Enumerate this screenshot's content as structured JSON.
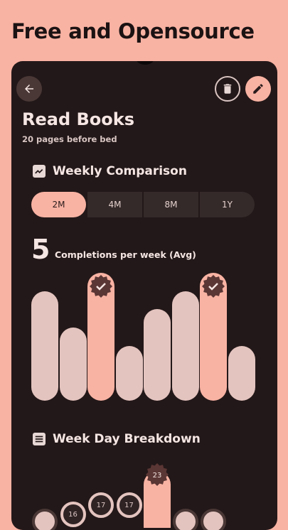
{
  "promo": {
    "title": "Free and Opensource"
  },
  "header": {
    "back_icon": "arrow-left-icon",
    "delete_icon": "trash-icon",
    "edit_icon": "pencil-icon"
  },
  "habit": {
    "title": "Read Books",
    "subtitle": "20 pages before bed"
  },
  "weekly": {
    "heading": "Weekly Comparison",
    "icon": "trending-up-icon",
    "ranges": [
      "2M",
      "4M",
      "8M",
      "1Y"
    ],
    "selected_range": "2M",
    "avg_value": "5",
    "avg_label": "Completions per week (Avg)",
    "bars": [
      {
        "value": 6,
        "highlight": false,
        "badge": false
      },
      {
        "value": 4,
        "highlight": false,
        "badge": false
      },
      {
        "value": 7,
        "highlight": true,
        "badge": true
      },
      {
        "value": 3,
        "highlight": false,
        "badge": false
      },
      {
        "value": 5,
        "highlight": false,
        "badge": false
      },
      {
        "value": 6,
        "highlight": false,
        "badge": false
      },
      {
        "value": 7,
        "highlight": true,
        "badge": true
      },
      {
        "value": 3,
        "highlight": false,
        "badge": false
      }
    ]
  },
  "weekday": {
    "heading": "Week Day Breakdown",
    "icon": "calendar-icon",
    "values": [
      "",
      "16",
      "17",
      "17",
      "23",
      "",
      ""
    ]
  },
  "colors": {
    "accent": "#f9b3a3",
    "background": "#231819",
    "bar": "#e4c4bf"
  }
}
